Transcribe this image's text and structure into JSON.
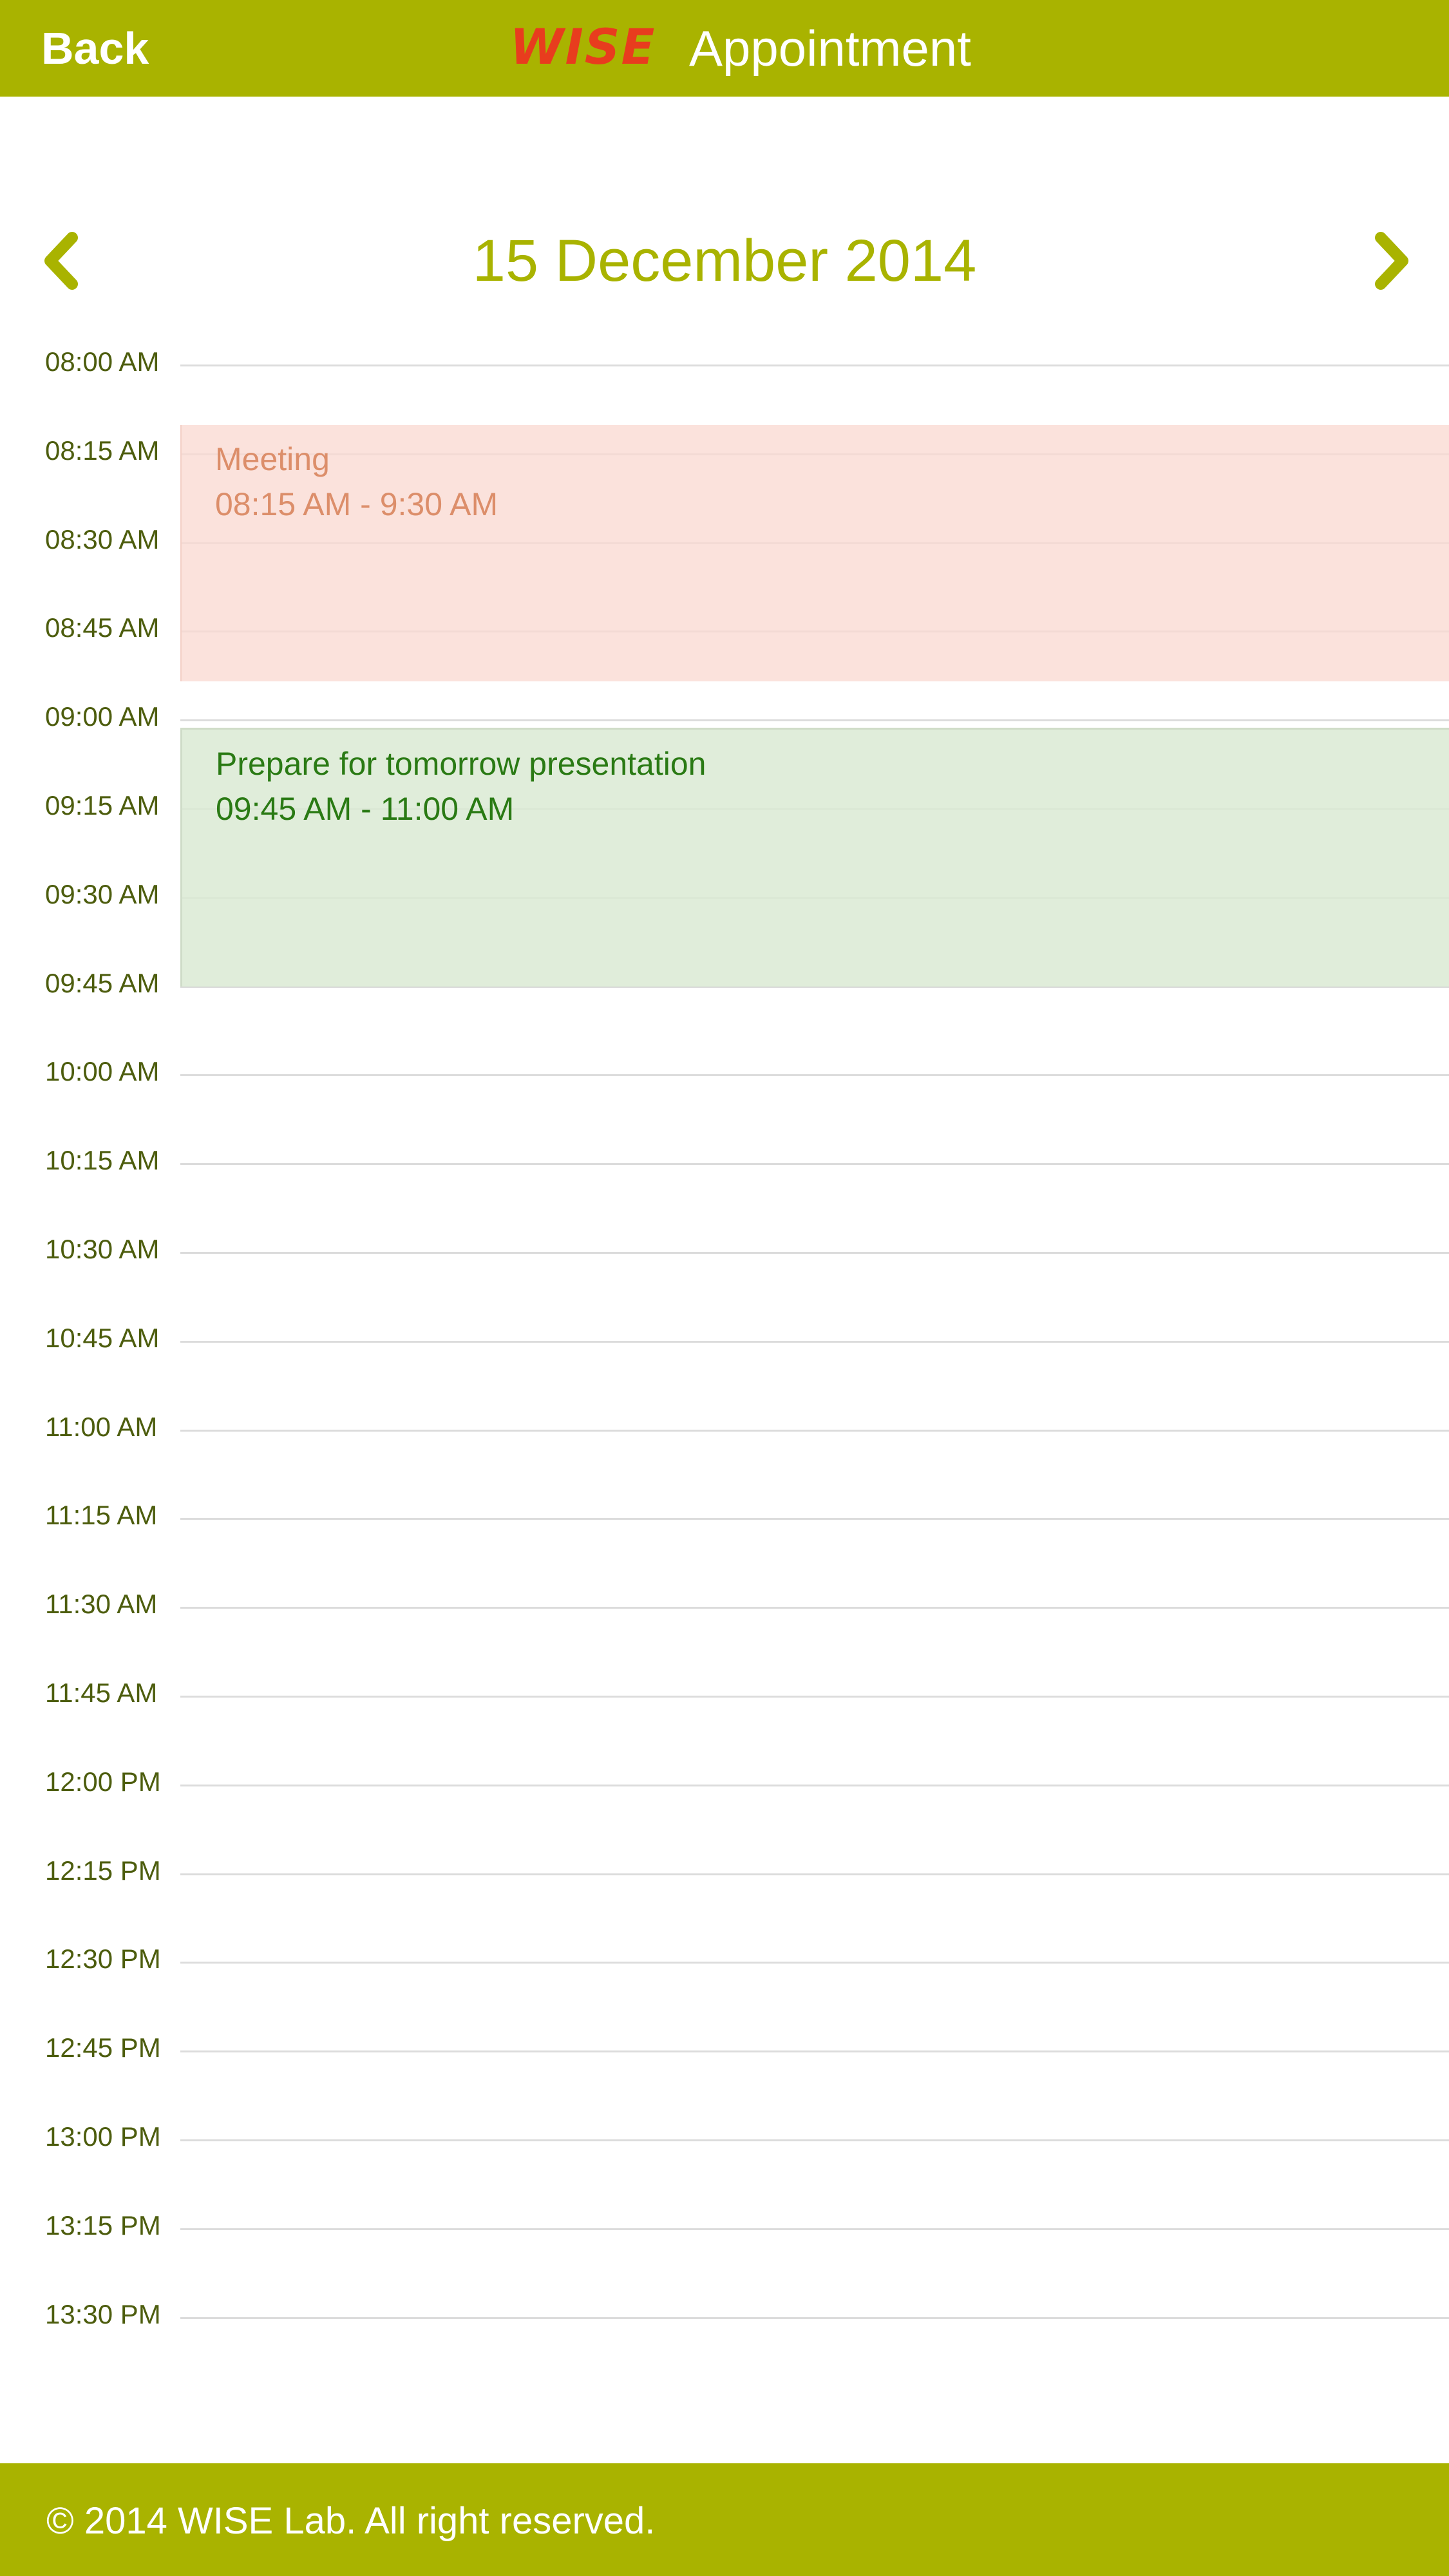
{
  "header": {
    "back_label": "Back",
    "logo_text": "WISE",
    "title": "Appointment"
  },
  "date_nav": {
    "date": "15 December 2014",
    "prev_icon": "chevron-left-icon",
    "next_icon": "chevron-right-icon"
  },
  "timeline": {
    "slots": [
      "08:00 AM",
      "08:15 AM",
      "08:30 AM",
      "08:45 AM",
      "09:00 AM",
      "09:15 AM",
      "09:30 AM",
      "09:45 AM",
      "10:00 AM",
      "10:15 AM",
      "10:30 AM",
      "10:45 AM",
      "11:00 AM",
      "11:15 AM",
      "11:30 AM",
      "11:45 AM",
      "12:00 PM",
      "12:15 PM",
      "12:30 PM",
      "12:45 PM",
      "13:00 PM",
      "13:15 PM",
      "13:30 PM"
    ]
  },
  "events": [
    {
      "title": "Meeting",
      "time": "08:15 AM - 9:30 AM",
      "color": "#dc8e6a",
      "background": "#fadad2"
    },
    {
      "title": "Prepare for tomorrow presentation",
      "time": "09:45 AM - 11:00 AM",
      "color": "#2a7a14",
      "background": "#dbead3"
    }
  ],
  "footer": {
    "copyright": "© 2014 WISE Lab. All right reserved."
  },
  "colors": {
    "accent": "#a9b300",
    "logo": "#e83c1e",
    "time_label": "#4d5d0e"
  }
}
